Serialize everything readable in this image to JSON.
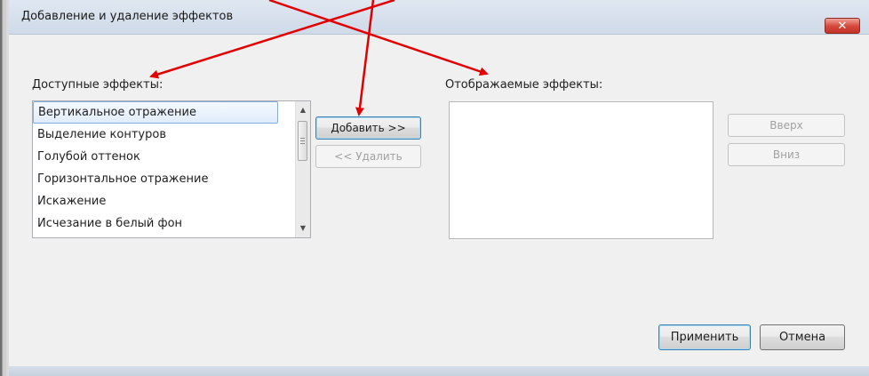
{
  "window": {
    "title": "Добавление и удаление эффектов",
    "close_glyph": "✕"
  },
  "available": {
    "label": "Доступные эффекты:",
    "items": [
      {
        "label": "Вертикальное отражение",
        "selected": true
      },
      {
        "label": "Выделение контуров"
      },
      {
        "label": "Голубой оттенок"
      },
      {
        "label": "Горизонтальное отражение"
      },
      {
        "label": "Искажение"
      },
      {
        "label": "Исчезание в белый фон"
      }
    ],
    "scroll_up_glyph": "▲",
    "scroll_down_glyph": "▼"
  },
  "actions": {
    "add_label": "Добавить >>",
    "remove_label": "<< Удалить"
  },
  "shown": {
    "label": "Отображаемые эффекты:",
    "items": []
  },
  "order": {
    "up_label": "Вверх",
    "down_label": "Вниз"
  },
  "footer": {
    "apply_label": "Применить",
    "cancel_label": "Отмена"
  },
  "annotations": {
    "arrow_color": "#e00000"
  },
  "colors": {
    "titlebar": "#d6e0ec",
    "close_button": "#d04a3c",
    "selection_border": "#84acdd"
  }
}
